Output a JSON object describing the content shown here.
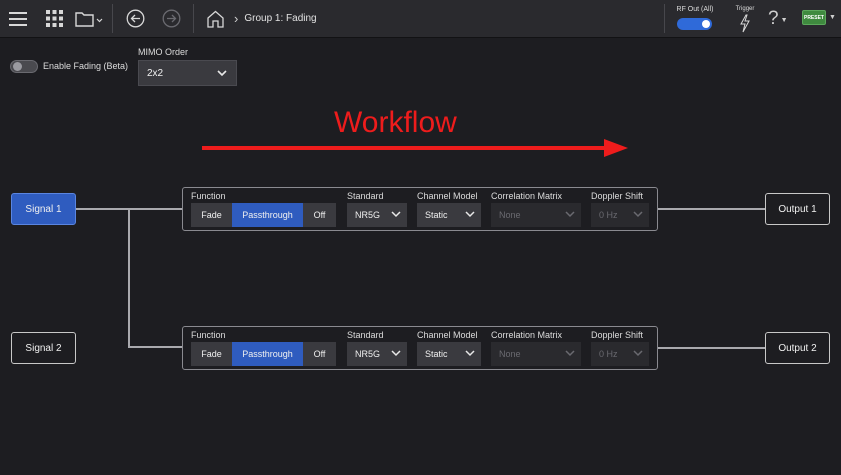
{
  "breadcrumb": {
    "current": "Group 1: Fading"
  },
  "top_right": {
    "rf_out_label": "RF Out (All)",
    "rf_out_on": true,
    "trigger_label": "Trigger",
    "help_symbol": "?",
    "preset_label": "PRESET"
  },
  "controls": {
    "enable_fading_label": "Enable Fading (Beta)",
    "enable_fading_on": false,
    "mimo_label": "MIMO Order",
    "mimo_value": "2x2"
  },
  "workflow": {
    "label": "Workflow",
    "color": "#ee1c1c"
  },
  "channels": [
    {
      "signal_label": "Signal 1",
      "signal_selected": true,
      "output_label": "Output 1",
      "function_label": "Function",
      "function_options": [
        "Fade",
        "Passthrough",
        "Off"
      ],
      "function_selected": "Passthrough",
      "standard_label": "Standard",
      "standard_value": "NR5G",
      "channel_model_label": "Channel Model",
      "channel_model_value": "Static",
      "correlation_label": "Correlation Matrix",
      "correlation_value": "None",
      "doppler_label": "Doppler Shift",
      "doppler_value": "0 Hz"
    },
    {
      "signal_label": "Signal 2",
      "signal_selected": false,
      "output_label": "Output 2",
      "function_label": "Function",
      "function_options": [
        "Fade",
        "Passthrough",
        "Off"
      ],
      "function_selected": "Passthrough",
      "standard_label": "Standard",
      "standard_value": "NR5G",
      "channel_model_label": "Channel Model",
      "channel_model_value": "Static",
      "correlation_label": "Correlation Matrix",
      "correlation_value": "None",
      "doppler_label": "Doppler Shift",
      "doppler_value": "0 Hz"
    }
  ],
  "icons": {
    "menu": "hamburger-menu-icon",
    "apps": "app-grid-icon",
    "folder": "folder-icon",
    "back": "back-arrow-icon",
    "forward": "forward-arrow-icon",
    "home": "home-icon",
    "trigger": "lightning-icon"
  },
  "colors": {
    "accent": "#2f5cbf",
    "toggle_on": "#2f6ad9",
    "preset": "#3f8a3f"
  }
}
